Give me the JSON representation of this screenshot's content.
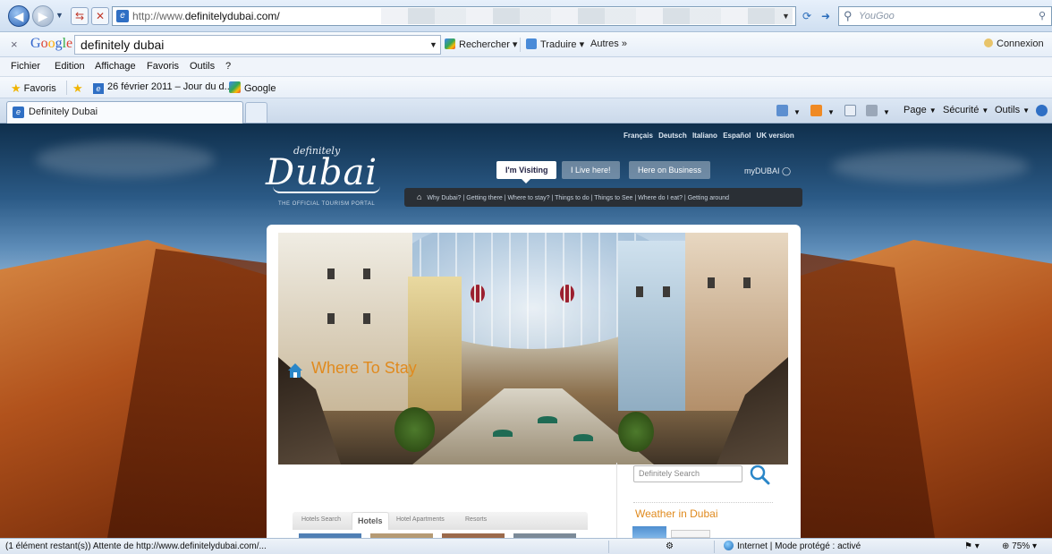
{
  "browser": {
    "address": {
      "url_prefix": "http://www.",
      "url_domain": "definitelydubai.com/"
    },
    "search_placeholder": "YouGoo",
    "google_bar": {
      "logo": "Google",
      "query": "definitely dubai",
      "search_label": "Rechercher",
      "translate_label": "Traduire",
      "more_label": "Autres »",
      "login_label": "Connexion"
    },
    "menu": [
      "Fichier",
      "Edition",
      "Affichage",
      "Favoris",
      "Outils",
      "?"
    ],
    "favorites": {
      "label": "Favoris",
      "items": [
        "26 février 2011 – Jour du d...",
        "Google"
      ]
    },
    "tab": {
      "title": "Definitely Dubai"
    },
    "commands": {
      "page": "Page",
      "security": "Sécurité",
      "tools": "Outils"
    },
    "status": {
      "text": "(1 élément restant(s)) Attente de http://www.definitelydubai.com/...",
      "zone": "Internet | Mode protégé : activé",
      "zoom": "75%"
    }
  },
  "site": {
    "languages": [
      "Français",
      "Deutsch",
      "Italiano",
      "Español",
      "UK version"
    ],
    "logo_small": "definitely",
    "logo_main": "Dubai",
    "tagline": "THE OFFICIAL TOURISM PORTAL",
    "audience_tabs": [
      {
        "label": "I'm Visiting",
        "active": true
      },
      {
        "label": "I Live here!",
        "active": false
      },
      {
        "label": "Here on Business",
        "active": false
      }
    ],
    "mydubai": "myDUBAI",
    "subnav": [
      "Why Dubai?",
      "Getting there",
      "Where to stay?",
      "Things to do",
      "Things to See",
      "Where do I eat?",
      "Getting around"
    ],
    "section_title": "Where To Stay",
    "hotel_tabs": [
      "Hotels Search",
      "Hotels",
      "Hotel Apartments",
      "Resorts"
    ],
    "search_placeholder": "Definitely Search",
    "weather_title": "Weather in Dubai"
  },
  "colors": {
    "accent_orange": "#e08a1e",
    "chrome_blue": "#dfe9f5",
    "subnav_bg": "#2a2f35"
  }
}
